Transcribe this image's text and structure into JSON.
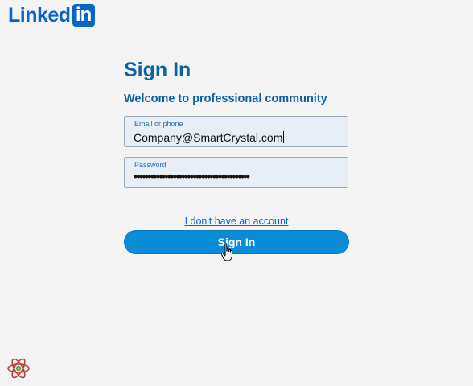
{
  "brand": {
    "logo_text": "Linked",
    "logo_badge": "in"
  },
  "form": {
    "title": "Sign In",
    "subtitle": "Welcome to professional community",
    "email_label": "Email or phone",
    "email_value": "Company@SmartCrystal.com",
    "password_label": "Password",
    "password_value": "•••••••••••••••••••••••••••••••••••••••••",
    "no_account_link": "I don't have an account",
    "submit_label": "Sign In"
  },
  "colors": {
    "brand_blue": "#0a66c2",
    "button_blue": "#0a8dd6",
    "field_bg": "#e8eef6"
  },
  "icons": {
    "cursor": "hand-pointer-icon",
    "corner": "react-logo-icon"
  }
}
